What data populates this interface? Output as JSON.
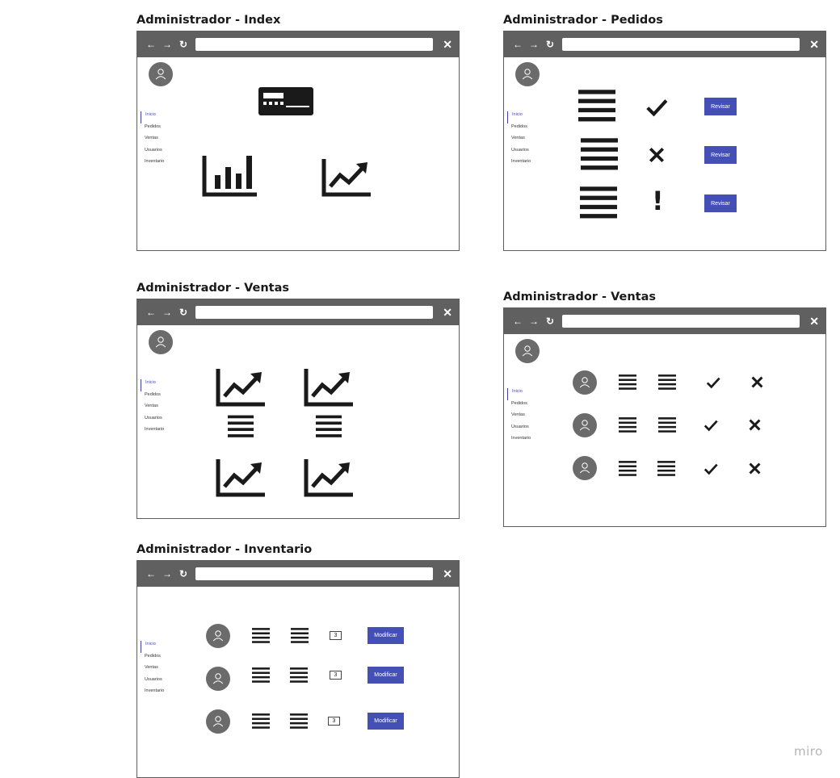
{
  "frames": [
    {
      "title": "Administrador - Index"
    },
    {
      "title": "Administrador - Pedidos"
    },
    {
      "title": "Administrador - Ventas"
    },
    {
      "title": "Administrador - Ventas"
    },
    {
      "title": "Administrador - Inventario"
    }
  ],
  "browser": {
    "back_icon": "arrow-left-icon",
    "forward_icon": "arrow-right-icon",
    "reload_icon": "refresh-icon",
    "close_icon": "close-icon",
    "back_glyph": "←",
    "forward_glyph": "→",
    "reload_glyph": "↻",
    "close_glyph": "✕"
  },
  "sidebar": {
    "items": [
      "Inicio",
      "Pedidos",
      "Ventas",
      "Usuarios",
      "Inventario"
    ]
  },
  "pedidos": {
    "button_label": "Revisar",
    "status_icons": [
      "check-icon",
      "cross-icon",
      "exclamation-icon"
    ],
    "exclamation_glyph": "!"
  },
  "inventario": {
    "quantity_values": [
      "3",
      "3",
      "3"
    ],
    "button_label": "Modificar"
  },
  "watermark": "miro",
  "colors": {
    "browser_bar": "#606060",
    "accent_button": "#4450b5",
    "avatar": "#6b6b6b",
    "icon": "#1a1a1a"
  }
}
